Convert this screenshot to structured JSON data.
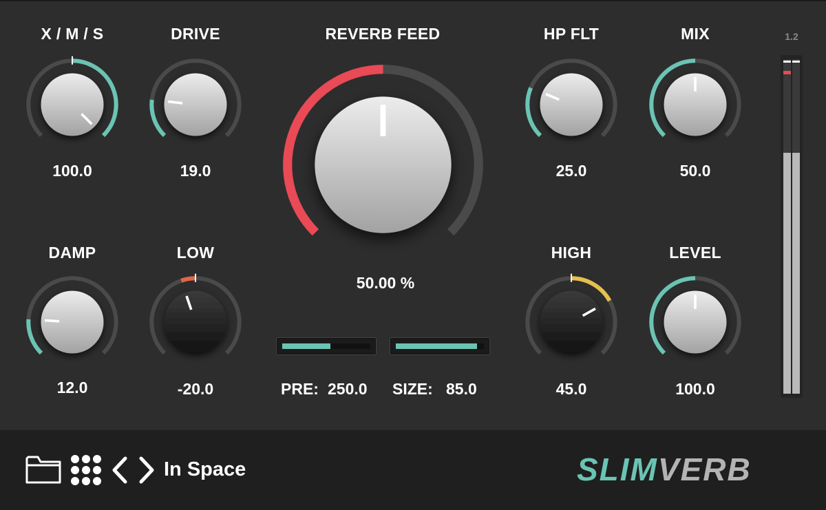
{
  "app": {
    "name": "SLIMVERB"
  },
  "knobs": [
    {
      "id": "xms",
      "label": "X / M / S",
      "value": "100.0",
      "fraction": 1.0,
      "bipolar": true,
      "color": "#6bc4b3",
      "cap": "light"
    },
    {
      "id": "drive",
      "label": "DRIVE",
      "value": "19.0",
      "fraction": 0.19,
      "bipolar": false,
      "color": "#6bc4b3",
      "cap": "light"
    },
    {
      "id": "hpflt",
      "label": "HP FLT",
      "value": "25.0",
      "fraction": 0.25,
      "bipolar": false,
      "color": "#6bc4b3",
      "cap": "light"
    },
    {
      "id": "mix",
      "label": "MIX",
      "value": "50.0",
      "fraction": 0.5,
      "bipolar": false,
      "color": "#6bc4b3",
      "cap": "light"
    },
    {
      "id": "damp",
      "label": "DAMP",
      "value": "12.0",
      "fraction": 0.18,
      "bipolar": false,
      "color": "#6bc4b3",
      "cap": "light"
    },
    {
      "id": "low",
      "label": "LOW",
      "value": "-20.0",
      "fraction": 0.43,
      "bipolar": true,
      "color": "#e0664a",
      "cap": "dark"
    },
    {
      "id": "high",
      "label": "HIGH",
      "value": "45.0",
      "fraction": 0.725,
      "bipolar": true,
      "color": "#e5c04c",
      "cap": "dark"
    },
    {
      "id": "level",
      "label": "LEVEL",
      "value": "100.0",
      "fraction": 0.5,
      "bipolar": false,
      "color": "#6bc4b3",
      "cap": "light"
    }
  ],
  "main_knob": {
    "label": "REVERB FEED",
    "value": "50.00 %",
    "fraction": 0.5,
    "color": "#e94a55"
  },
  "sliders": {
    "pre": {
      "label": "PRE:",
      "value": "250.0",
      "fraction": 0.55,
      "color": "#6bc4b3"
    },
    "size": {
      "label": "SIZE:",
      "value": "85.0",
      "fraction": 0.92,
      "color": "#6bc4b3"
    }
  },
  "meter": {
    "scale_label": "1.2",
    "level_fraction": 0.72,
    "peak_color": "#e94a55"
  },
  "bottom_bar": {
    "preset_name": "In Space",
    "icons": [
      "folder-icon",
      "grid-icon",
      "chevron-left-icon",
      "chevron-right-icon"
    ]
  },
  "logo": {
    "part1": "SLIM",
    "part2": "VERB",
    "part1_color": "#6bc4b3",
    "part2_color": "#b4b4b4"
  }
}
